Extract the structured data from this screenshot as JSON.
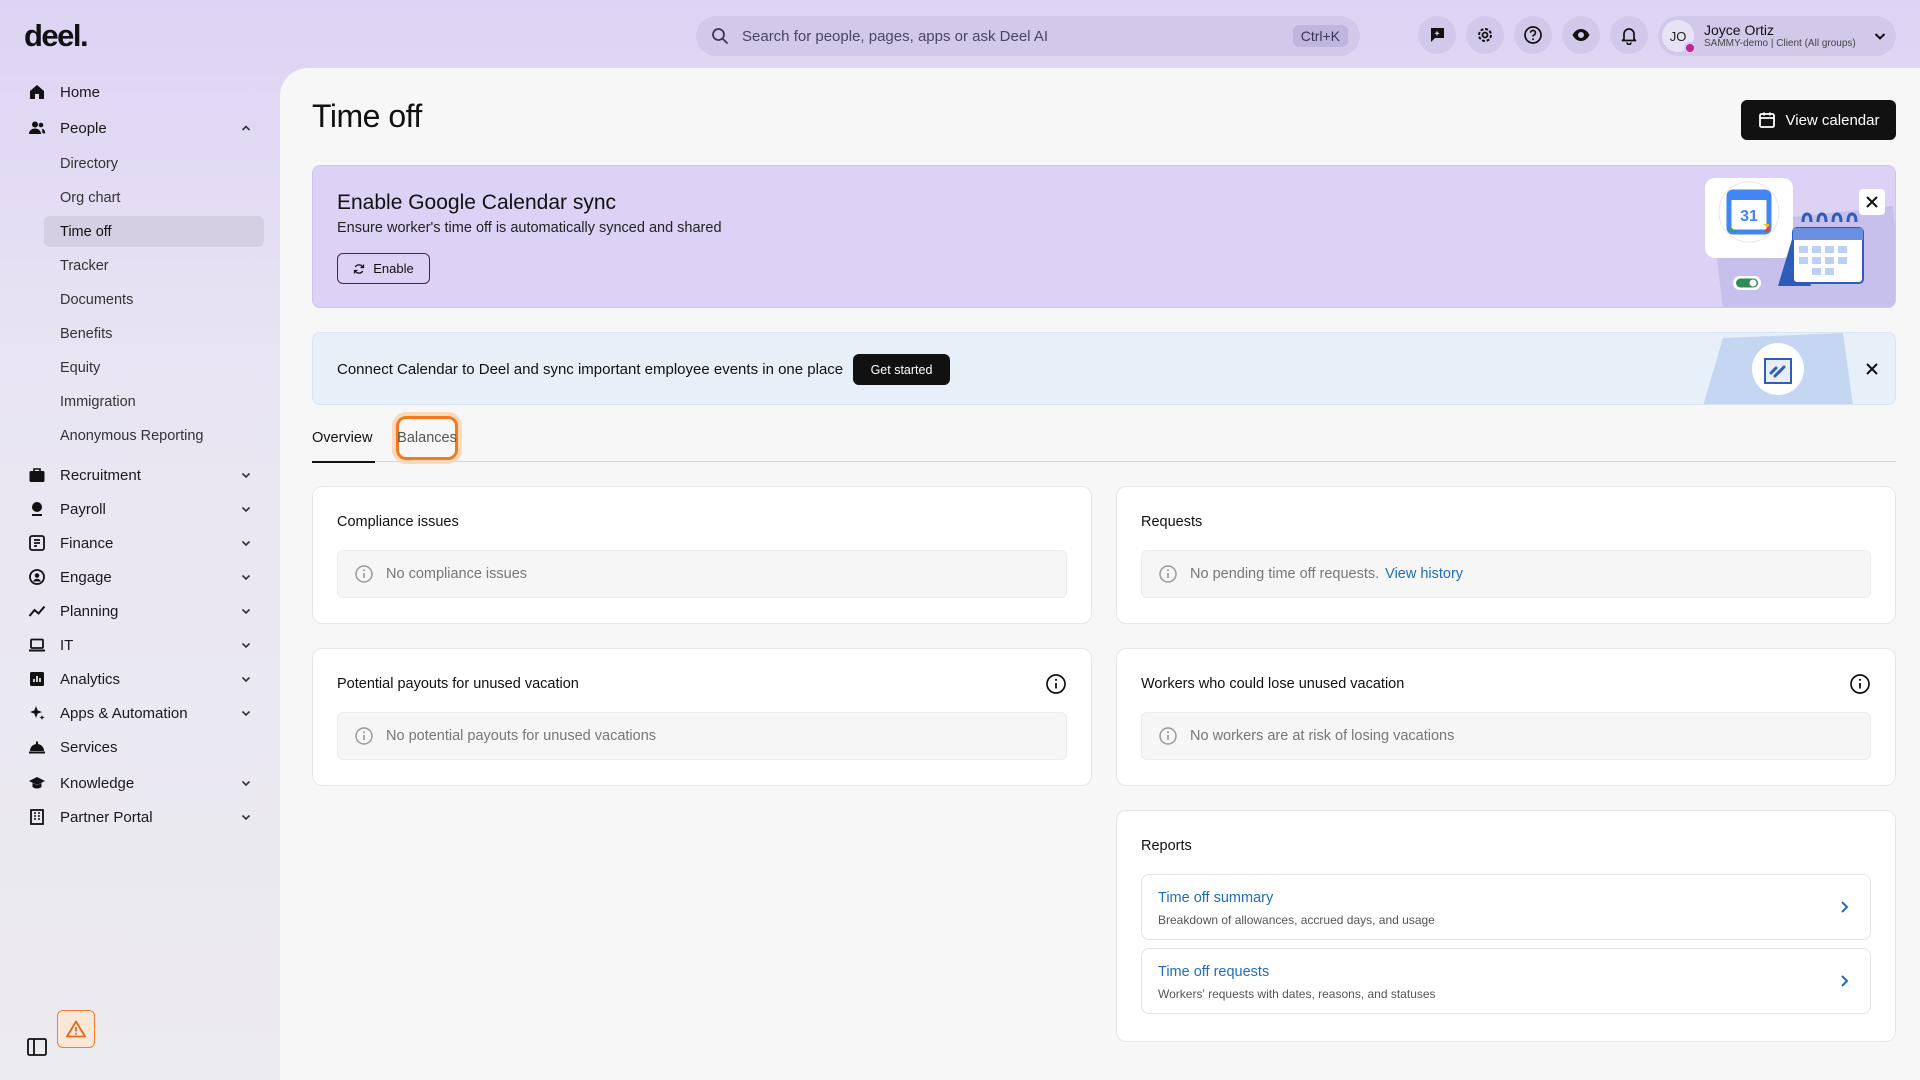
{
  "app": {
    "logo": "deel."
  },
  "search": {
    "placeholder": "Search for people, pages, apps or ask Deel AI",
    "shortcut": "Ctrl+K"
  },
  "topbar": {
    "icons": [
      "feedback-icon",
      "gear-icon",
      "help-icon",
      "eye-icon",
      "bell-icon"
    ],
    "user": {
      "initials": "JO",
      "name": "Joyce Ortiz",
      "org": "SAMMY-demo | Client (All groups)"
    }
  },
  "sidebar": {
    "items": [
      {
        "label": "Home",
        "icon": "home-icon"
      },
      {
        "label": "People",
        "icon": "people-icon",
        "expanded": true
      },
      {
        "label": "Recruitment",
        "icon": "briefcase-icon"
      },
      {
        "label": "Payroll",
        "icon": "payroll-icon"
      },
      {
        "label": "Finance",
        "icon": "finance-icon"
      },
      {
        "label": "Engage",
        "icon": "engage-icon"
      },
      {
        "label": "Planning",
        "icon": "planning-icon"
      },
      {
        "label": "IT",
        "icon": "laptop-icon"
      },
      {
        "label": "Analytics",
        "icon": "analytics-icon"
      },
      {
        "label": "Apps & Automation",
        "icon": "sparkle-icon"
      },
      {
        "label": "Services",
        "icon": "bell-service-icon"
      },
      {
        "label": "Knowledge",
        "icon": "graduation-icon"
      },
      {
        "label": "Partner Portal",
        "icon": "building-icon"
      }
    ],
    "people_sub": [
      {
        "label": "Directory"
      },
      {
        "label": "Org chart"
      },
      {
        "label": "Time off",
        "active": true
      },
      {
        "label": "Tracker"
      },
      {
        "label": "Documents"
      },
      {
        "label": "Benefits"
      },
      {
        "label": "Equity"
      },
      {
        "label": "Immigration"
      },
      {
        "label": "Anonymous Reporting"
      }
    ]
  },
  "page": {
    "title": "Time off",
    "view_calendar": "View calendar"
  },
  "banner_sync": {
    "title": "Enable Google Calendar sync",
    "description": "Ensure worker's time off is automatically synced and shared",
    "button": "Enable",
    "calendar_day": "31"
  },
  "banner_connect": {
    "text": "Connect Calendar to Deel and sync important employee events in one place",
    "button": "Get started"
  },
  "tabs": [
    {
      "label": "Overview",
      "active": true
    },
    {
      "label": "Balances",
      "focused": true
    }
  ],
  "cards": {
    "compliance": {
      "title": "Compliance issues",
      "empty": "No compliance issues"
    },
    "requests": {
      "title": "Requests",
      "empty": "No pending time off requests.",
      "link": "View history"
    },
    "payouts": {
      "title": "Potential payouts for unused vacation",
      "empty": "No potential payouts for unused vacations"
    },
    "workers": {
      "title": "Workers who could lose unused vacation",
      "empty": "No workers are at risk of losing vacations"
    },
    "reports": {
      "title": "Reports",
      "items": [
        {
          "title": "Time off summary",
          "description": "Breakdown of allowances, accrued days, and usage"
        },
        {
          "title": "Time off requests",
          "description": "Workers' requests with dates, reasons, and statuses"
        }
      ]
    }
  },
  "colors": {
    "accent_purple": "#dcd2f5",
    "link_blue": "#1f6dbf",
    "focus_orange": "#f07b1f"
  }
}
